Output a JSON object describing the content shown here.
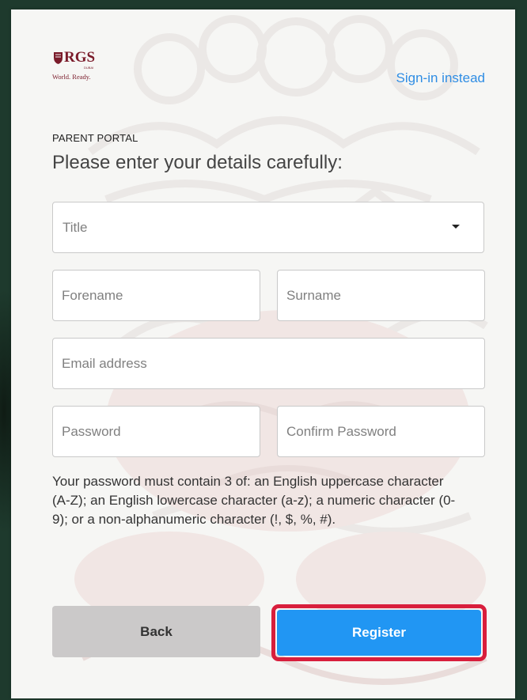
{
  "brand": {
    "name": "RGS",
    "sub": "DUBAI",
    "tagline": "World. Ready.",
    "color": "#7a1b2a"
  },
  "header": {
    "signin_label": "Sign-in instead",
    "portal_label": "PARENT PORTAL",
    "heading": "Please enter your details carefully:"
  },
  "form": {
    "title_placeholder": "Title",
    "forename_placeholder": "Forename",
    "surname_placeholder": "Surname",
    "email_placeholder": "Email address",
    "password_placeholder": "Password",
    "confirm_password_placeholder": "Confirm Password",
    "password_hint": "Your password must contain 3 of: an English uppercase character (A-Z); an English lowercase character (a-z); a numeric character (0-9); or a non-alphanumeric character (!, $, %, #)."
  },
  "actions": {
    "back_label": "Back",
    "register_label": "Register"
  },
  "colors": {
    "accent": "#2196f3",
    "link": "#2f8de4",
    "highlight": "#d81e3c",
    "background": "#1e3a2d"
  }
}
